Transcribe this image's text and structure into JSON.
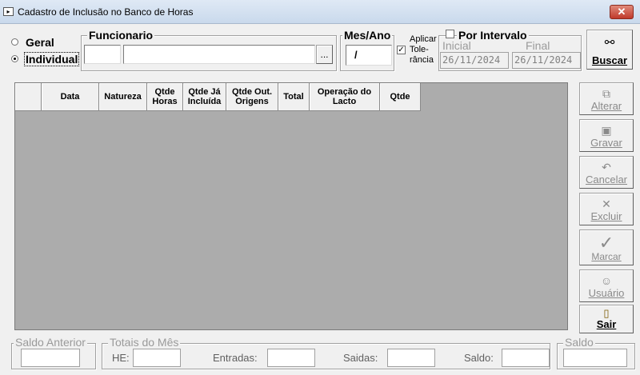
{
  "window": {
    "title": "Cadastro de Inclusão no Banco de Horas",
    "close_label": "✕"
  },
  "filters": {
    "radio_geral": "Geral",
    "radio_individual": "Individual",
    "selected": "Individual",
    "funcionario_group": "Funcionario",
    "funcionario_code": "",
    "funcionario_name": "",
    "lookup_label": "...",
    "mes_ano_group": "Mes/Ano",
    "mes_ano_value": "/",
    "aplicar_line1": "Aplicar",
    "aplicar_line2": "Tole-",
    "aplicar_line3": "rância",
    "aplicar_checked": "✓",
    "intervalo_label": "Por Intervalo",
    "inicial_label": "Inicial",
    "inicial_value": "26/11/2024",
    "final_label": "Final",
    "final_value": "26/11/2024",
    "buscar_label": "Buscar"
  },
  "grid": {
    "columns": [
      {
        "label": ""
      },
      {
        "label": "Data"
      },
      {
        "label": "Natureza"
      },
      {
        "label": "Qtde Horas"
      },
      {
        "label": "Qtde Já Incluída"
      },
      {
        "label": "Qtde Out. Origens"
      },
      {
        "label": "Total"
      },
      {
        "label": "Operação do Lacto"
      },
      {
        "label": "Qtde"
      }
    ],
    "rows": []
  },
  "actions": {
    "alterar": "Alterar",
    "gravar": "Gravar",
    "cancelar": "Cancelar",
    "excluir": "Excluir",
    "marcar": "Marcar",
    "usuario": "Usuário",
    "sair": "Sair"
  },
  "totals": {
    "saldo_anterior_group": "Saldo Anterior",
    "saldo_anterior_value": "",
    "totais_group": "Totais do Mês",
    "he_label": "HE:",
    "he_value": "",
    "entradas_label": "Entradas:",
    "entradas_value": "",
    "saidas_label": "Saidas:",
    "saidas_value": "",
    "saldo_label": "Saldo:",
    "saldo_value": "",
    "saldo_group": "Saldo",
    "saldo_group_value": ""
  }
}
